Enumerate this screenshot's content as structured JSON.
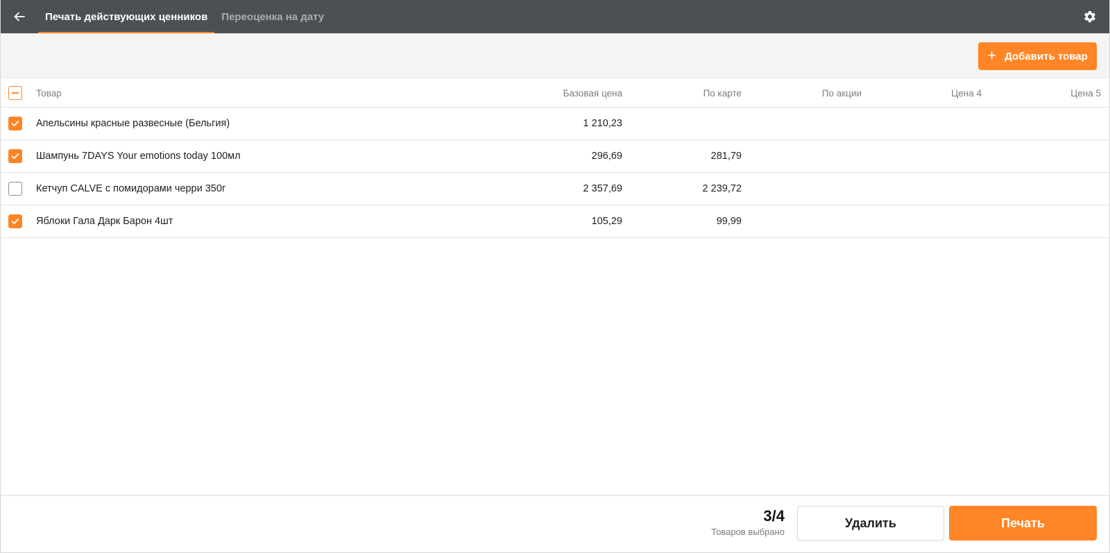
{
  "header": {
    "tabs": [
      {
        "label": "Печать действующих ценников",
        "active": true
      },
      {
        "label": "Переоценка на дату",
        "active": false
      }
    ],
    "back_icon": "arrow-left-icon",
    "settings_icon": "gear-icon"
  },
  "toolbar": {
    "add_label": "Добавить товар",
    "add_icon": "plus-icon"
  },
  "table": {
    "columns": {
      "name": "Товар",
      "base": "Базовая цена",
      "card": "По карте",
      "promo": "По акции",
      "price4": "Цена 4",
      "price5": "Цена 5"
    },
    "select_all_state": "partial",
    "rows": [
      {
        "checked": true,
        "name": "Апельсины красные развесные (Бельгия)",
        "base": "1 210,23",
        "card": "",
        "promo": "",
        "price4": "",
        "price5": ""
      },
      {
        "checked": true,
        "name": "Шампунь 7DAYS Your emotions today 100мл",
        "base": "296,69",
        "card": "281,79",
        "promo": "",
        "price4": "",
        "price5": ""
      },
      {
        "checked": false,
        "name": "Кетчуп CALVE с помидорами черри 350г",
        "base": "2 357,69",
        "card": "2 239,72",
        "promo": "",
        "price4": "",
        "price5": ""
      },
      {
        "checked": true,
        "name": "Яблоки Гала Дарк Барон 4шт",
        "base": "105,29",
        "card": "99,99",
        "promo": "",
        "price4": "",
        "price5": ""
      }
    ]
  },
  "footer": {
    "count": "3/4",
    "count_label": "Товаров выбрано",
    "delete_label": "Удалить",
    "print_label": "Печать"
  },
  "colors": {
    "accent": "#ff8526",
    "header_bg": "#4c5054"
  }
}
